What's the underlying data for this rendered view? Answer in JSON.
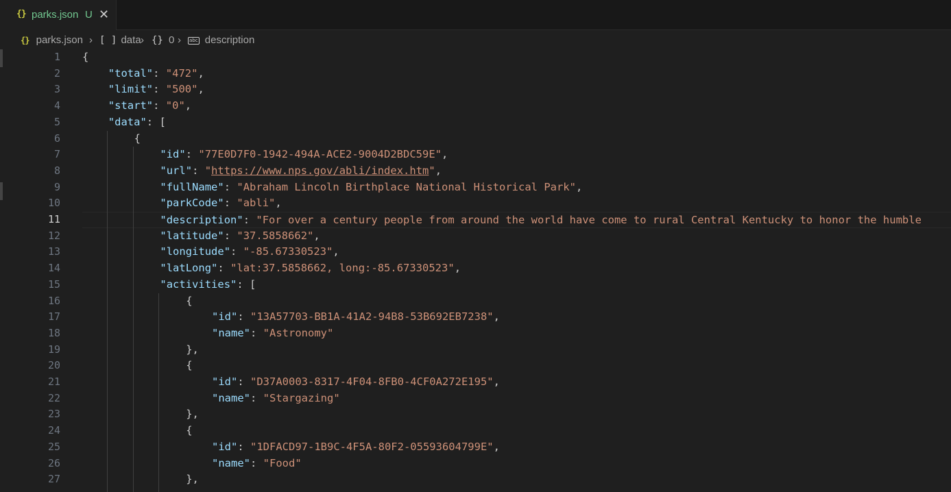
{
  "tab": {
    "icon": "{}",
    "title": "parks.json",
    "status": "U",
    "close": "✕"
  },
  "breadcrumbs": [
    {
      "icon": "{}",
      "label": "parks.json"
    },
    {
      "icon": "[ ]",
      "label": "data"
    },
    {
      "icon": "{}",
      "label": "0"
    },
    {
      "icon": "abc",
      "label": "description"
    }
  ],
  "colors": {
    "key": "#9cdcfe",
    "string": "#ce9178",
    "punctuation": "#cccccc",
    "line_number": "#6e7681"
  },
  "active_line": 11,
  "lines": [
    {
      "n": "1",
      "indent": 0,
      "parts": [
        [
          "p",
          "{"
        ]
      ]
    },
    {
      "n": "2",
      "indent": 1,
      "parts": [
        [
          "k",
          "\"total\""
        ],
        [
          "p",
          ": "
        ],
        [
          "s",
          "\"472\""
        ],
        [
          "p",
          ","
        ]
      ]
    },
    {
      "n": "3",
      "indent": 1,
      "parts": [
        [
          "k",
          "\"limit\""
        ],
        [
          "p",
          ": "
        ],
        [
          "s",
          "\"500\""
        ],
        [
          "p",
          ","
        ]
      ]
    },
    {
      "n": "4",
      "indent": 1,
      "parts": [
        [
          "k",
          "\"start\""
        ],
        [
          "p",
          ": "
        ],
        [
          "s",
          "\"0\""
        ],
        [
          "p",
          ","
        ]
      ]
    },
    {
      "n": "5",
      "indent": 1,
      "parts": [
        [
          "k",
          "\"data\""
        ],
        [
          "p",
          ": ["
        ]
      ]
    },
    {
      "n": "6",
      "indent": 2,
      "parts": [
        [
          "p",
          "{"
        ]
      ]
    },
    {
      "n": "7",
      "indent": 3,
      "parts": [
        [
          "k",
          "\"id\""
        ],
        [
          "p",
          ": "
        ],
        [
          "s",
          "\"77E0D7F0-1942-494A-ACE2-9004D2BDC59E\""
        ],
        [
          "p",
          ","
        ]
      ]
    },
    {
      "n": "8",
      "indent": 3,
      "parts": [
        [
          "k",
          "\"url\""
        ],
        [
          "p",
          ": "
        ],
        [
          "s",
          "\""
        ],
        [
          "sl",
          "https://www.nps.gov/abli/index.htm"
        ],
        [
          "s",
          "\""
        ],
        [
          "p",
          ","
        ]
      ]
    },
    {
      "n": "9",
      "indent": 3,
      "parts": [
        [
          "k",
          "\"fullName\""
        ],
        [
          "p",
          ": "
        ],
        [
          "s",
          "\"Abraham Lincoln Birthplace National Historical Park\""
        ],
        [
          "p",
          ","
        ]
      ]
    },
    {
      "n": "10",
      "indent": 3,
      "parts": [
        [
          "k",
          "\"parkCode\""
        ],
        [
          "p",
          ": "
        ],
        [
          "s",
          "\"abli\""
        ],
        [
          "p",
          ","
        ]
      ]
    },
    {
      "n": "11",
      "indent": 3,
      "parts": [
        [
          "k",
          "\"description\""
        ],
        [
          "p",
          ": "
        ],
        [
          "s",
          "\"For over a century people from around the world have come to rural Central Kentucky to honor the humble"
        ]
      ]
    },
    {
      "n": "12",
      "indent": 3,
      "parts": [
        [
          "k",
          "\"latitude\""
        ],
        [
          "p",
          ": "
        ],
        [
          "s",
          "\"37.5858662\""
        ],
        [
          "p",
          ","
        ]
      ]
    },
    {
      "n": "13",
      "indent": 3,
      "parts": [
        [
          "k",
          "\"longitude\""
        ],
        [
          "p",
          ": "
        ],
        [
          "s",
          "\"-85.67330523\""
        ],
        [
          "p",
          ","
        ]
      ]
    },
    {
      "n": "14",
      "indent": 3,
      "parts": [
        [
          "k",
          "\"latLong\""
        ],
        [
          "p",
          ": "
        ],
        [
          "s",
          "\"lat:37.5858662, long:-85.67330523\""
        ],
        [
          "p",
          ","
        ]
      ]
    },
    {
      "n": "15",
      "indent": 3,
      "parts": [
        [
          "k",
          "\"activities\""
        ],
        [
          "p",
          ": ["
        ]
      ]
    },
    {
      "n": "16",
      "indent": 4,
      "parts": [
        [
          "p",
          "{"
        ]
      ]
    },
    {
      "n": "17",
      "indent": 5,
      "parts": [
        [
          "k",
          "\"id\""
        ],
        [
          "p",
          ": "
        ],
        [
          "s",
          "\"13A57703-BB1A-41A2-94B8-53B692EB7238\""
        ],
        [
          "p",
          ","
        ]
      ]
    },
    {
      "n": "18",
      "indent": 5,
      "parts": [
        [
          "k",
          "\"name\""
        ],
        [
          "p",
          ": "
        ],
        [
          "s",
          "\"Astronomy\""
        ]
      ]
    },
    {
      "n": "19",
      "indent": 4,
      "parts": [
        [
          "p",
          "},"
        ]
      ]
    },
    {
      "n": "20",
      "indent": 4,
      "parts": [
        [
          "p",
          "{"
        ]
      ]
    },
    {
      "n": "21",
      "indent": 5,
      "parts": [
        [
          "k",
          "\"id\""
        ],
        [
          "p",
          ": "
        ],
        [
          "s",
          "\"D37A0003-8317-4F04-8FB0-4CF0A272E195\""
        ],
        [
          "p",
          ","
        ]
      ]
    },
    {
      "n": "22",
      "indent": 5,
      "parts": [
        [
          "k",
          "\"name\""
        ],
        [
          "p",
          ": "
        ],
        [
          "s",
          "\"Stargazing\""
        ]
      ]
    },
    {
      "n": "23",
      "indent": 4,
      "parts": [
        [
          "p",
          "},"
        ]
      ]
    },
    {
      "n": "24",
      "indent": 4,
      "parts": [
        [
          "p",
          "{"
        ]
      ]
    },
    {
      "n": "25",
      "indent": 5,
      "parts": [
        [
          "k",
          "\"id\""
        ],
        [
          "p",
          ": "
        ],
        [
          "s",
          "\"1DFACD97-1B9C-4F5A-80F2-05593604799E\""
        ],
        [
          "p",
          ","
        ]
      ]
    },
    {
      "n": "26",
      "indent": 5,
      "parts": [
        [
          "k",
          "\"name\""
        ],
        [
          "p",
          ": "
        ],
        [
          "s",
          "\"Food\""
        ]
      ]
    },
    {
      "n": "27",
      "indent": 4,
      "parts": [
        [
          "p",
          "},"
        ]
      ]
    }
  ]
}
